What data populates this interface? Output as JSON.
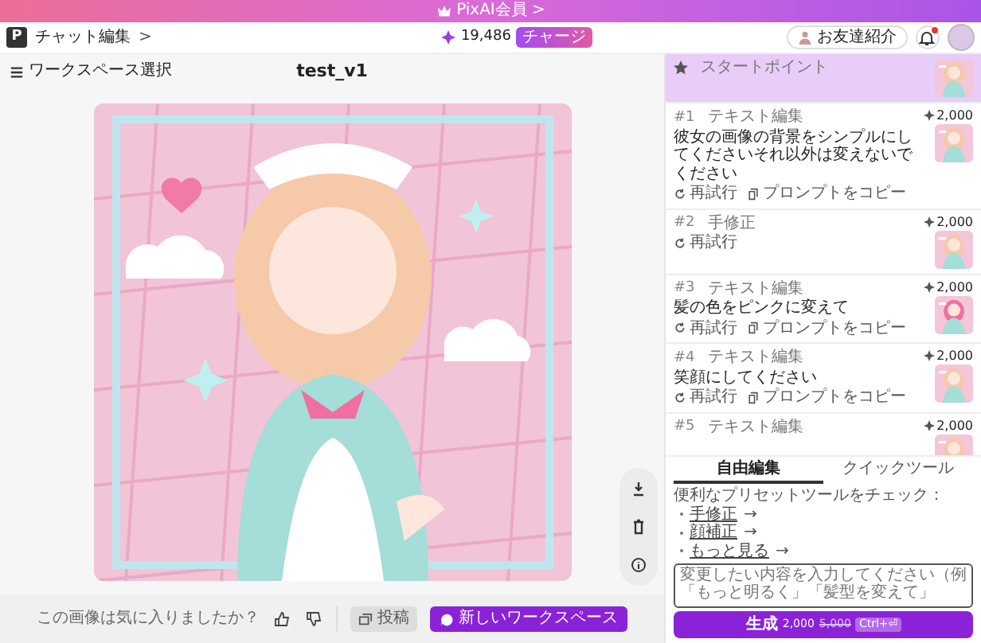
{
  "banner": {
    "label": "PixAI会員",
    "chevron": ">"
  },
  "header": {
    "logo": "P",
    "title": "チャット編集",
    "chevron": ">",
    "credits": "19,486",
    "charge_button": "チャージ",
    "invite_button": "お友達紹介",
    "notification_dot": true
  },
  "toolbar": {
    "workspace_button": "ワークスペース選択",
    "title": "test_v1"
  },
  "feedback": {
    "question": "この画像は気に入りましたか？",
    "post_button": "投稿",
    "new_workspace_button": "新しいワークスペース"
  },
  "history": [
    {
      "kind": "start",
      "label": "スタートポイント",
      "selected": true
    },
    {
      "kind": "edit",
      "number": "#1",
      "label": "テキスト編集",
      "cost": "2,000",
      "prompt": "彼女の画像の背景をシンプルにしてくださいそれ以外は変えないでください",
      "actions": [
        "再試行",
        "プロンプトをコピー"
      ],
      "selected": false
    },
    {
      "kind": "edit",
      "number": "#2",
      "label": "手修正",
      "cost": "2,000",
      "actions": [
        "再試行"
      ],
      "selected": false
    },
    {
      "kind": "edit",
      "number": "#3",
      "label": "テキスト編集",
      "cost": "2,000",
      "prompt": "髪の色をピンクに変えて",
      "actions": [
        "再試行",
        "プロンプトをコピー"
      ],
      "selected": false
    },
    {
      "kind": "edit",
      "number": "#4",
      "label": "テキスト編集",
      "cost": "2,000",
      "prompt": "笑顔にしてください",
      "actions": [
        "再試行",
        "プロンプトをコピー"
      ],
      "selected": false
    },
    {
      "kind": "edit",
      "number": "#5",
      "label": "テキスト編集",
      "cost": "2,000",
      "selected": false
    }
  ],
  "tabs": [
    {
      "label": "自由編集",
      "selected": true
    },
    {
      "label": "クイックツール",
      "selected": false
    }
  ],
  "presets": {
    "intro": "便利なプリセットツールをチェック：",
    "links": [
      {
        "label": "手修正",
        "arrow": "→"
      },
      {
        "label": "顔補正",
        "arrow": "→"
      },
      {
        "label": "もっと見る",
        "arrow": "→"
      }
    ]
  },
  "prompt_field": {
    "placeholder": "変更したい内容を入力してください（例「もっと明るく」「髪型を変えて」"
  },
  "generate_button": {
    "label": "生成",
    "price": "2,000",
    "original_price": "5,000",
    "shortcut": "Ctrl+⏎"
  }
}
